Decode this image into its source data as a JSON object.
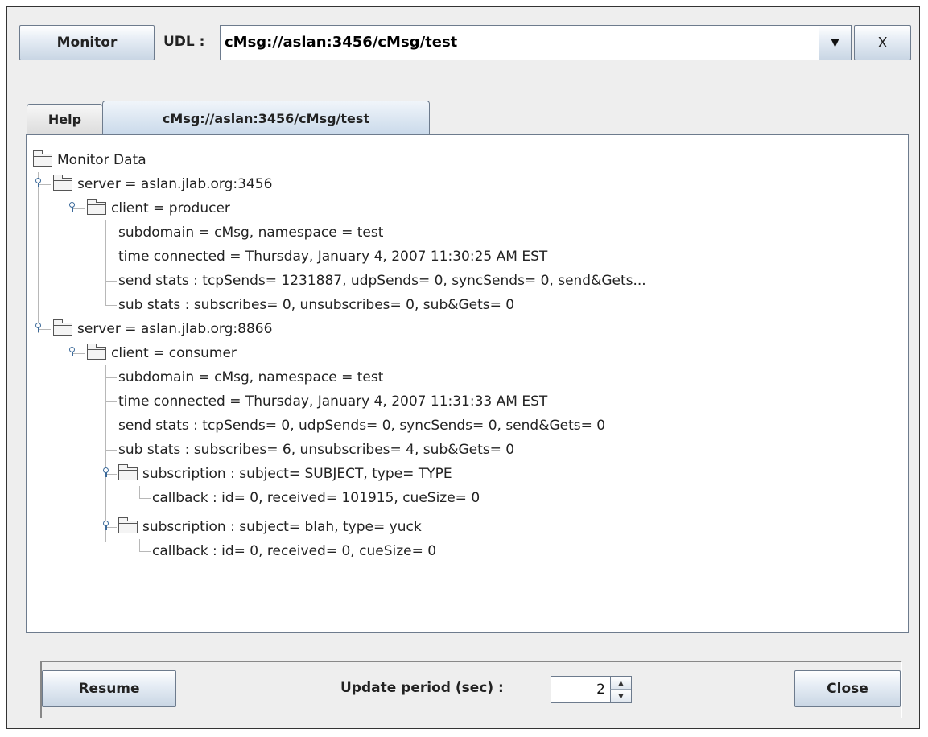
{
  "toolbar": {
    "monitor_label": "Monitor",
    "udl_label": "UDL :",
    "udl_value": "cMsg://aslan:3456/cMsg/test",
    "close_x_label": "X"
  },
  "tabs": [
    {
      "label": "Help"
    },
    {
      "label": "cMsg://aslan:3456/cMsg/test"
    }
  ],
  "tree": {
    "root": "Monitor Data",
    "rows": [
      "server = aslan.jlab.org:3456",
      "client = producer",
      "subdomain = cMsg,  namespace = test",
      "time connected = Thursday, January 4, 2007 11:30:25 AM EST",
      "send stats : tcpSends= 1231887,  udpSends= 0,  syncSends= 0,  send&Gets...",
      "sub stats : subscribes= 0,  unsubscribes= 0,  sub&Gets= 0",
      "server = aslan.jlab.org:8866",
      "client = consumer",
      "subdomain = cMsg,  namespace = test",
      "time connected = Thursday, January 4, 2007 11:31:33 AM EST",
      "send stats : tcpSends= 0,  udpSends= 0,  syncSends= 0,  send&Gets= 0",
      "sub stats : subscribes= 6,  unsubscribes= 4,  sub&Gets= 0",
      "subscription :  subject= SUBJECT,  type= TYPE",
      "callback : id= 0,  received= 101915, cueSize= 0",
      "subscription :  subject= blah,  type= yuck",
      "callback : id= 0,  received= 0, cueSize= 0"
    ]
  },
  "bottom": {
    "resume_label": "Resume",
    "update_period_label": "Update period (sec) :",
    "update_period_value": "2",
    "close_label": "Close"
  },
  "colors": {
    "button_gradient_bottom": "#c9d6e4",
    "border": "#6d7b8d",
    "tree_line": "#b8b8b8",
    "toggle": "#3c6a9a"
  }
}
